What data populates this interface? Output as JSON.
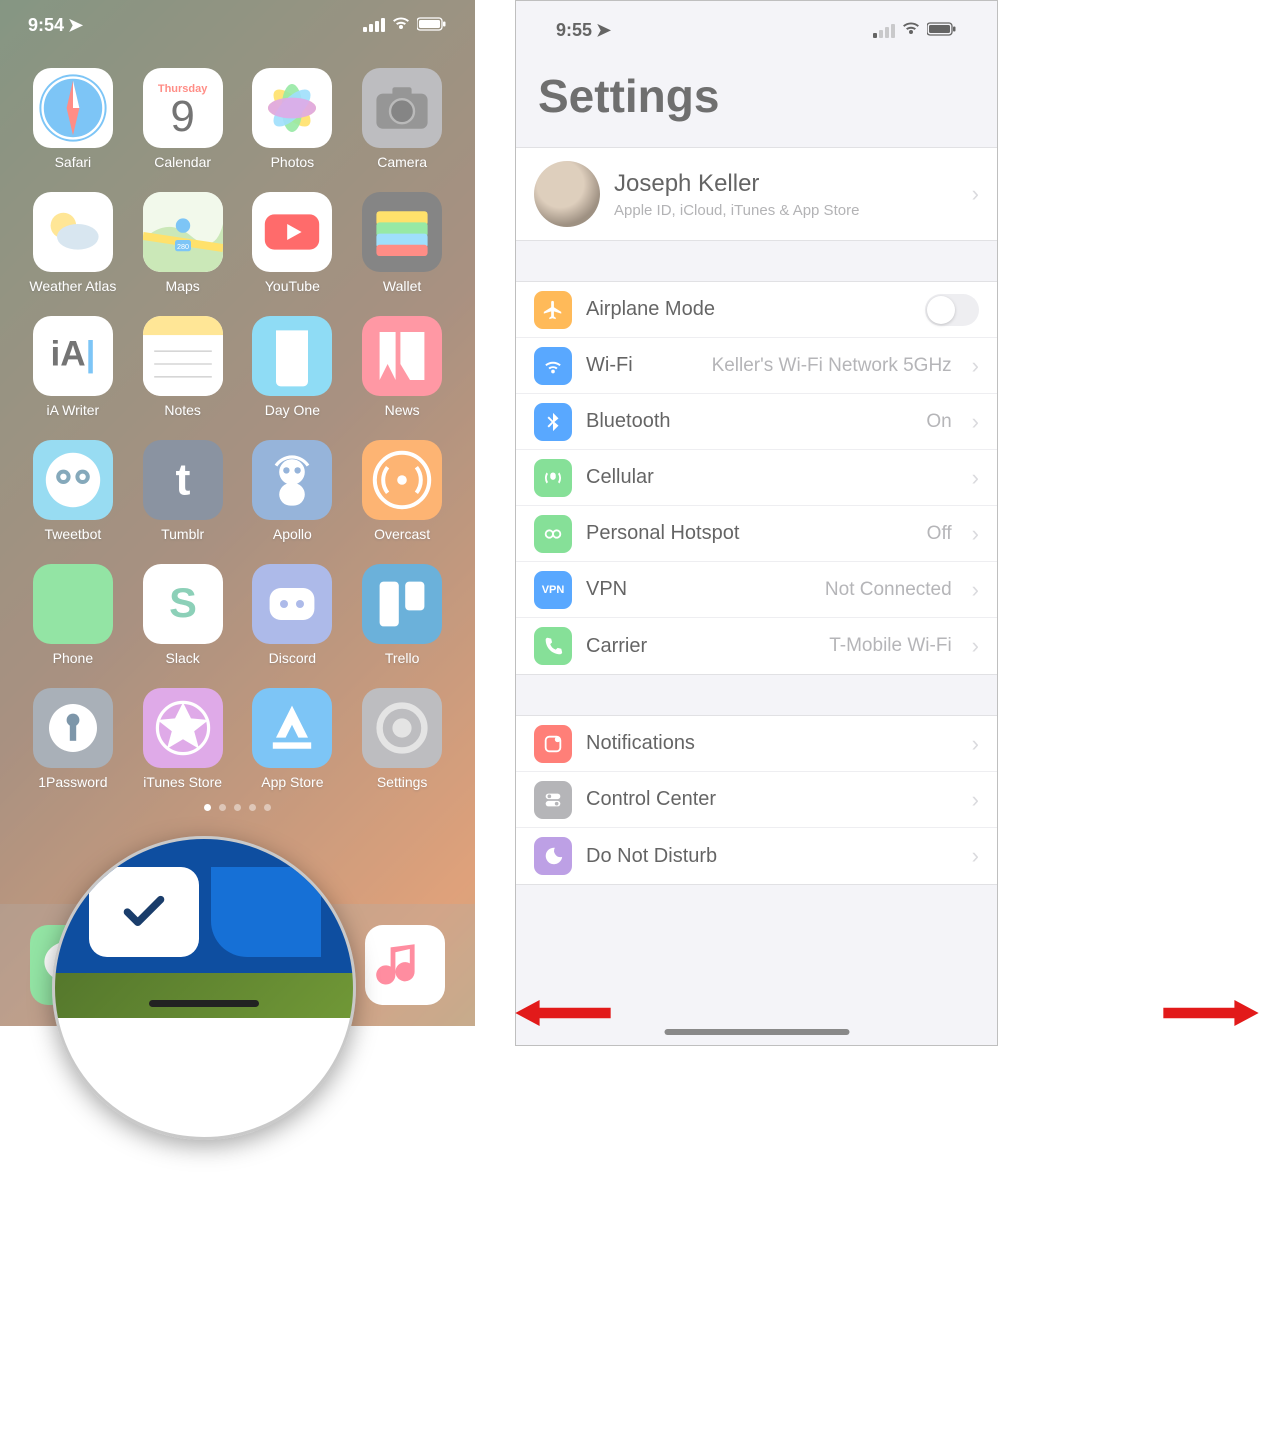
{
  "left": {
    "status": {
      "time": "9:54",
      "location_icon": "location-arrow",
      "wifi": "wifi-icon",
      "battery": "battery-icon",
      "signal": "signal-icon"
    },
    "apps": [
      {
        "name": "Safari",
        "icon": "safari",
        "bg": "#ffffff"
      },
      {
        "name": "Calendar",
        "icon": "calendar",
        "bg": "#ffffff",
        "day": "Thursday",
        "date": "9"
      },
      {
        "name": "Photos",
        "icon": "photos",
        "bg": "#ffffff"
      },
      {
        "name": "Camera",
        "icon": "camera",
        "bg": "#8e8e93"
      },
      {
        "name": "Weather Atlas",
        "icon": "weather",
        "bg": "#ffffff"
      },
      {
        "name": "Maps",
        "icon": "maps",
        "bg": "#ffffff"
      },
      {
        "name": "YouTube",
        "icon": "youtube",
        "bg": "#ffffff"
      },
      {
        "name": "Wallet",
        "icon": "wallet",
        "bg": "#2e2e2e"
      },
      {
        "name": "iA Writer",
        "icon": "iawriter",
        "bg": "#ffffff"
      },
      {
        "name": "Notes",
        "icon": "notes",
        "bg": "#ffffff"
      },
      {
        "name": "Day One",
        "icon": "dayone",
        "bg": "#3fc3ee"
      },
      {
        "name": "News",
        "icon": "news",
        "bg": "#ff4e63"
      },
      {
        "name": "Tweetbot",
        "icon": "tweetbot",
        "bg": "#4fc3e8"
      },
      {
        "name": "Tumblr",
        "icon": "tumblr",
        "bg": "#36465d"
      },
      {
        "name": "Apollo",
        "icon": "apollo",
        "bg": "#4a7fbf"
      },
      {
        "name": "Overcast",
        "icon": "overcast",
        "bg": "#fc7e0f"
      },
      {
        "name": "Phone",
        "icon": "phone",
        "bg": "#45d062"
      },
      {
        "name": "Slack",
        "icon": "slack",
        "bg": "#ffffff"
      },
      {
        "name": "Discord",
        "icon": "discord",
        "bg": "#7289da"
      },
      {
        "name": "Trello",
        "icon": "trello",
        "bg": "#0079bf"
      },
      {
        "name": "1Password",
        "icon": "onepassword",
        "bg": "#6b7785"
      },
      {
        "name": "iTunes Store",
        "icon": "itunes",
        "bg": "#c86dd7"
      },
      {
        "name": "App Store",
        "icon": "appstore",
        "bg": "#1f9cf0"
      },
      {
        "name": "Settings",
        "icon": "settings",
        "bg": "#8e8e93"
      }
    ],
    "dock": [
      {
        "name": "Messages",
        "icon": "messages",
        "bg": "#45d062"
      },
      {
        "name": "Things",
        "icon": "things",
        "bg": "#0e4ea0"
      },
      {
        "name": "Spark",
        "icon": "spark",
        "bg": "#1670d6"
      },
      {
        "name": "Music",
        "icon": "music",
        "bg": "#ffffff"
      }
    ]
  },
  "right": {
    "status": {
      "time": "9:55",
      "location_icon": "location-arrow",
      "wifi": "wifi-icon",
      "battery": "battery-icon",
      "signal": "signal-weak-icon"
    },
    "title": "Settings",
    "profile": {
      "name": "Joseph Keller",
      "subtitle": "Apple ID, iCloud, iTunes & App Store"
    },
    "rows_connectivity": [
      {
        "key": "airplane",
        "label": "Airplane Mode",
        "value": "",
        "type": "toggle",
        "icon_bg": "#ff9500",
        "icon": "airplane-icon"
      },
      {
        "key": "wifi",
        "label": "Wi-Fi",
        "value": "Keller's Wi-Fi Network 5GHz",
        "type": "link",
        "icon_bg": "#007aff",
        "icon": "wifi-icon"
      },
      {
        "key": "bluetooth",
        "label": "Bluetooth",
        "value": "On",
        "type": "link",
        "icon_bg": "#007aff",
        "icon": "bluetooth-icon"
      },
      {
        "key": "cellular",
        "label": "Cellular",
        "value": "",
        "type": "link",
        "icon_bg": "#45d062",
        "icon": "cellular-icon"
      },
      {
        "key": "hotspot",
        "label": "Personal Hotspot",
        "value": "Off",
        "type": "link",
        "icon_bg": "#45d062",
        "icon": "hotspot-icon"
      },
      {
        "key": "vpn",
        "label": "VPN",
        "value": "Not Connected",
        "type": "link",
        "icon_bg": "#007aff",
        "icon": "vpn-icon",
        "text_icon": "VPN"
      },
      {
        "key": "carrier",
        "label": "Carrier",
        "value": "T-Mobile Wi-Fi",
        "type": "link",
        "icon_bg": "#45d062",
        "icon": "phone-icon"
      }
    ],
    "rows_system": [
      {
        "key": "notifications",
        "label": "Notifications",
        "value": "",
        "type": "link",
        "icon_bg": "#ff3b30",
        "icon": "notifications-icon"
      },
      {
        "key": "controlcenter",
        "label": "Control Center",
        "value": "",
        "type": "link",
        "icon_bg": "#8e8e93",
        "icon": "controlcenter-icon"
      },
      {
        "key": "dnd",
        "label": "Do Not Disturb",
        "value": "",
        "type": "link",
        "icon_bg": "#9a6dd7",
        "icon": "moon-icon"
      }
    ]
  },
  "annotations": {
    "magnifier": "magnifier-home-indicator",
    "arrow_left": "swipe-left-arrow",
    "arrow_right": "swipe-right-arrow",
    "home_indicator": "home-indicator"
  }
}
